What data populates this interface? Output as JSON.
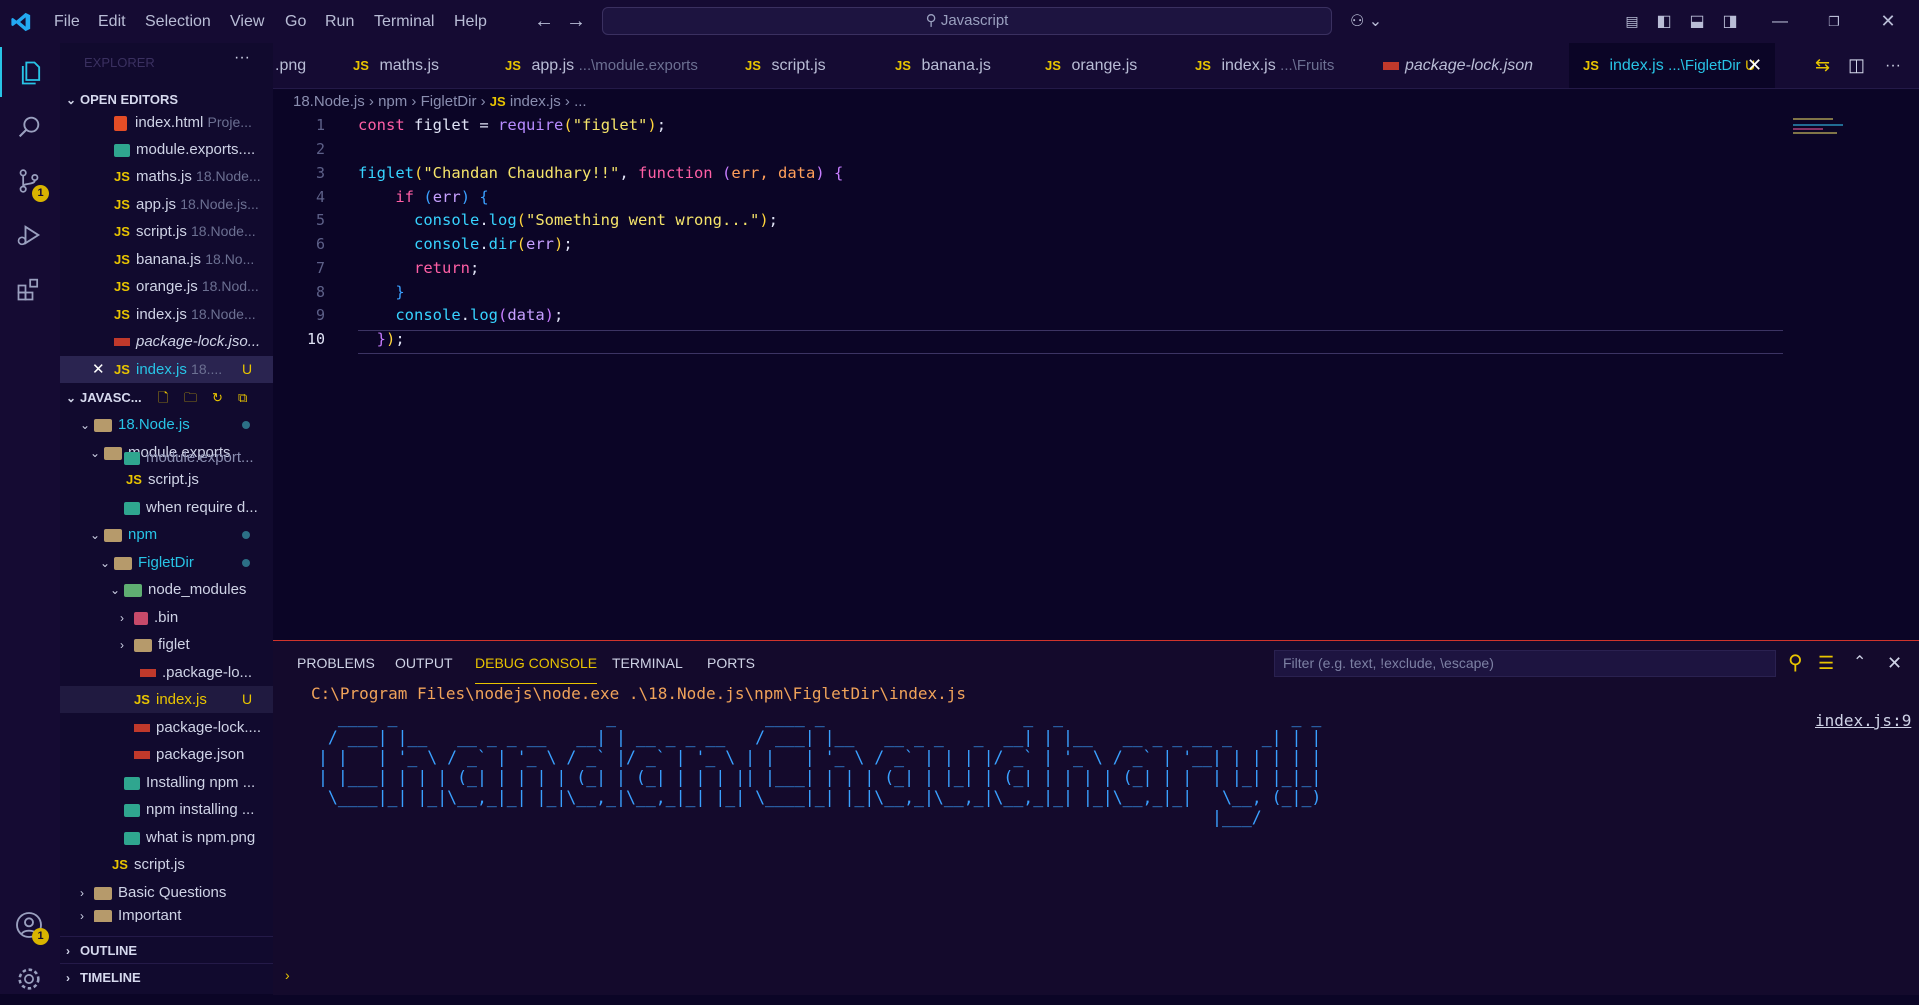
{
  "titlebar": {
    "menu": [
      "File",
      "Edit",
      "Selection",
      "View",
      "Go",
      "Run",
      "Terminal",
      "Help"
    ],
    "search_text": "Javascript"
  },
  "activity": {
    "scm_badge": "1",
    "account_badge": "1"
  },
  "sidebar": {
    "explorer_title": "EXPLORER",
    "open_editors_title": "OPEN EDITORS",
    "open_editors": [
      {
        "name": "index.html",
        "desc": "Proje...",
        "icon": "html5-icon"
      },
      {
        "name": "module.exports....",
        "desc": "",
        "icon": "image-icon"
      },
      {
        "name": "maths.js",
        "desc": "18.Node...",
        "icon": "js-icon"
      },
      {
        "name": "app.js",
        "desc": "18.Node.js...",
        "icon": "js-icon"
      },
      {
        "name": "script.js",
        "desc": "18.Node...",
        "icon": "js-icon"
      },
      {
        "name": "banana.js",
        "desc": "18.No...",
        "icon": "js-icon"
      },
      {
        "name": "orange.js",
        "desc": "18.Nod...",
        "icon": "js-icon"
      },
      {
        "name": "index.js",
        "desc": "18.Node...",
        "icon": "js-icon"
      },
      {
        "name": "package-lock.jso...",
        "desc": "",
        "icon": "npm-icon"
      },
      {
        "name": "index.js",
        "desc": "18....",
        "icon": "js-icon",
        "flag": "U"
      }
    ],
    "workspace_title": "JAVASC...",
    "tree": [
      {
        "name": "18.Node.js",
        "type": "folder"
      },
      {
        "name": "module.exports",
        "type": "folder"
      },
      {
        "name": "module.export...",
        "type": "image"
      },
      {
        "name": "script.js",
        "type": "js"
      },
      {
        "name": "when require d...",
        "type": "image"
      },
      {
        "name": "npm",
        "type": "folder"
      },
      {
        "name": "FigletDir",
        "type": "folder"
      },
      {
        "name": "node_modules",
        "type": "folder"
      },
      {
        "name": ".bin",
        "type": "folder"
      },
      {
        "name": "figlet",
        "type": "folder"
      },
      {
        "name": ".package-lo...",
        "type": "npm"
      },
      {
        "name": "index.js",
        "type": "js",
        "flag": "U"
      },
      {
        "name": "package-lock....",
        "type": "npm"
      },
      {
        "name": "package.json",
        "type": "npm"
      },
      {
        "name": "Installing npm ...",
        "type": "image"
      },
      {
        "name": "npm installing ...",
        "type": "image"
      },
      {
        "name": "what is npm.png",
        "type": "image"
      },
      {
        "name": "script.js",
        "type": "js"
      },
      {
        "name": "Basic Questions",
        "type": "folder"
      },
      {
        "name": "Important",
        "type": "folder"
      }
    ],
    "outline_title": "OUTLINE",
    "timeline_title": "TIMELINE"
  },
  "tabs": [
    {
      "label": ".png",
      "desc": ""
    },
    {
      "label": "maths.js",
      "desc": ""
    },
    {
      "label": "app.js",
      "desc": "...\\module.exports"
    },
    {
      "label": "script.js",
      "desc": ""
    },
    {
      "label": "banana.js",
      "desc": ""
    },
    {
      "label": "orange.js",
      "desc": ""
    },
    {
      "label": "index.js",
      "desc": "...\\Fruits"
    },
    {
      "label": "package-lock.json",
      "desc": ""
    },
    {
      "label": "index.js",
      "desc": "...\\FigletDir",
      "flag": "U"
    }
  ],
  "breadcrumb": [
    "18.Node.js",
    "npm",
    "FigletDir",
    "index.js",
    "..."
  ],
  "code_line_numbers": [
    "1",
    "2",
    "3",
    "4",
    "5",
    "6",
    "7",
    "8",
    "9",
    "10"
  ],
  "code": {
    "l1_const": "const",
    "l1_var": "figlet",
    "l1_eq": "=",
    "l1_require": "require",
    "l1_arg": "\"figlet\"",
    "l3_fn": "figlet",
    "l3_str": "\"Chandan Chaudhary!!\"",
    "l3_function": "function",
    "l3_params": "err, data",
    "l4_if": "if",
    "l4_cond": "err",
    "l5_obj": "console",
    "l5_m": "log",
    "l5_str": "\"Something went wrong...\"",
    "l6_obj": "console",
    "l6_m": "dir",
    "l6_arg": "err",
    "l7_return": "return",
    "l9_obj": "console",
    "l9_m": "log",
    "l9_arg": "data"
  },
  "panel": {
    "tabs": [
      "PROBLEMS",
      "OUTPUT",
      "DEBUG CONSOLE",
      "TERMINAL",
      "PORTS"
    ],
    "active_tab": "DEBUG CONSOLE",
    "filter_placeholder": "Filter (e.g. text, !exclude, \\escape)",
    "command": "C:\\Program Files\\nodejs\\node.exe .\\18.Node.js\\npm\\FigletDir\\index.js",
    "source_ref": "index.js:9",
    "figlet_output": "  ____ _                     _               ____ _                    _  _                       _ _ \n / ___| |__   __ _ _ __   __| | __ _ _ __   / ___| |__   __ _ _   _  __| | |__   __ _ _ __ _   _| | |\n| |   | '_ \\ / _` | '_ \\ / _` |/ _` | '_ \\ | |   | '_ \\ / _` | | | |/ _` | '_ \\ / _` | '__| | | | | |\n| |___| | | | (_| | | | | (_| | (_| | | | || |___| | | | (_| | |_| | (_| | | | | (_| | |  | |_| |_|_|\n \\____|_| |_|\\__,_|_| |_|\\__,_|\\__,_|_| |_| \\____|_| |_|\\__,_|\\__,_|\\__,_|_| |_|\\__,_|_|   \\__, (_|_)\n                                                                                          |___/     "
  },
  "colors": {
    "accent": "#28c4e6",
    "badge": "#d9b400",
    "panel_border": "#d0342c"
  }
}
